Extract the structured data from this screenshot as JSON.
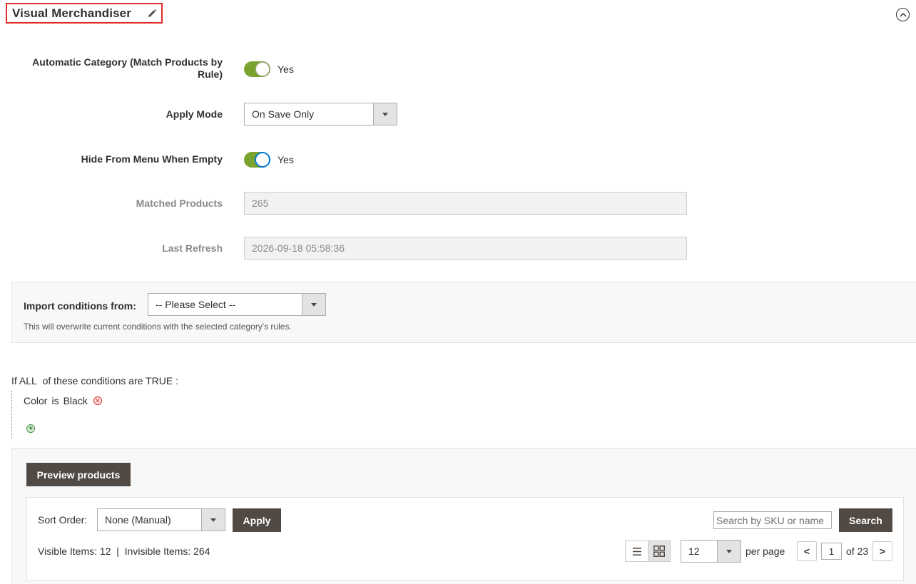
{
  "section": {
    "title": "Visual Merchandiser"
  },
  "fields": {
    "automatic_category": {
      "label": "Automatic Category (Match Products by Rule)",
      "value": "Yes"
    },
    "apply_mode": {
      "label": "Apply Mode",
      "value": "On Save Only"
    },
    "hide_from_menu": {
      "label": "Hide From Menu When Empty",
      "value": "Yes"
    },
    "matched_products": {
      "label": "Matched Products",
      "value": "265"
    },
    "last_refresh": {
      "label": "Last Refresh",
      "value": "2026-09-18 05:58:36"
    }
  },
  "import": {
    "label": "Import conditions from:",
    "select_value": "-- Please Select --",
    "note": "This will overwrite current conditions with the selected category's rules."
  },
  "conditions": {
    "prefix": "If",
    "aggregator": "ALL",
    "middle": "of these conditions are",
    "value": "TRUE",
    "suffix": ":",
    "item": {
      "attribute": "Color",
      "operator": "is",
      "value": "Black"
    }
  },
  "preview": {
    "button_label": "Preview products",
    "sort_label": "Sort Order:",
    "sort_value": "None (Manual)",
    "apply_label": "Apply",
    "search_placeholder": "Search by SKU or name",
    "search_label": "Search",
    "visible_items": "Visible Items: 12",
    "separator": "|",
    "invisible_items": "Invisible Items: 264",
    "per_page_value": "12",
    "per_page_label": "per page",
    "prev_label": "<",
    "page_value": "1",
    "page_total": "of 23",
    "next_label": ">"
  },
  "colors": {
    "toggle_on": "#79a22e",
    "dark_button": "#514943",
    "highlight_border": "#e02b27"
  }
}
